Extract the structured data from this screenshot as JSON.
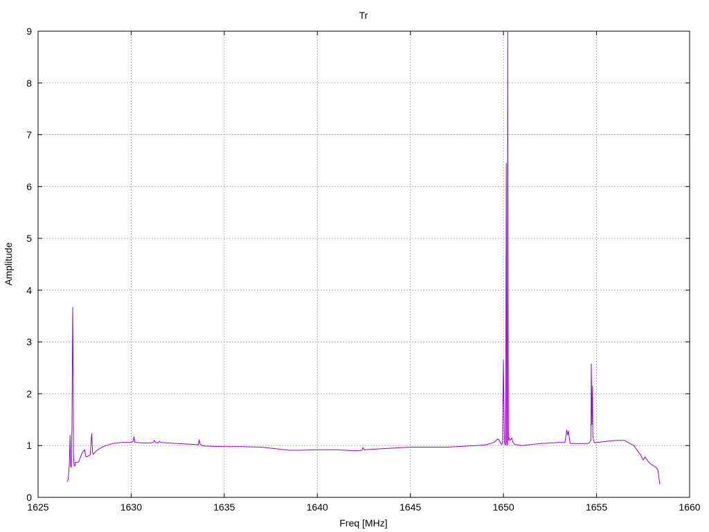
{
  "chart_data": {
    "type": "line",
    "title": "Tr",
    "xlabel": "Freq [MHz]",
    "ylabel": "Amplitude",
    "xlim": [
      1625,
      1660
    ],
    "ylim": [
      0,
      9
    ],
    "xticks": [
      1625,
      1630,
      1635,
      1640,
      1645,
      1650,
      1655,
      1660
    ],
    "yticks": [
      0,
      1,
      2,
      3,
      4,
      5,
      6,
      7,
      8,
      9
    ],
    "grid": true,
    "legend": "none",
    "series": [
      {
        "color": "#9400d3",
        "x": [
          1626.55,
          1626.62,
          1626.68,
          1626.72,
          1626.75,
          1626.78,
          1626.82,
          1626.86,
          1626.88,
          1626.9,
          1626.93,
          1626.97,
          1627.0,
          1627.1,
          1627.2,
          1627.3,
          1627.4,
          1627.5,
          1627.55,
          1627.6,
          1627.7,
          1627.8,
          1627.88,
          1627.93,
          1627.97,
          1628.0,
          1628.2,
          1628.5,
          1629.0,
          1629.5,
          1630.0,
          1630.1,
          1630.15,
          1630.2,
          1630.3,
          1630.6,
          1631.0,
          1631.2,
          1631.25,
          1631.3,
          1631.45,
          1631.5,
          1631.6,
          1632.0,
          1632.5,
          1633.0,
          1633.5,
          1633.6,
          1633.65,
          1633.7,
          1633.8,
          1634.0,
          1635.0,
          1636.0,
          1637.0,
          1638.0,
          1638.5,
          1639.0,
          1640.0,
          1641.0,
          1642.0,
          1642.4,
          1642.45,
          1642.5,
          1643.0,
          1644.0,
          1645.0,
          1646.0,
          1647.0,
          1648.0,
          1649.0,
          1649.5,
          1649.7,
          1649.8,
          1649.9,
          1649.95,
          1650.0,
          1650.05,
          1650.08,
          1650.12,
          1650.15,
          1650.18,
          1650.21,
          1650.23,
          1650.25,
          1650.27,
          1650.3,
          1650.35,
          1650.4,
          1650.45,
          1650.5,
          1650.6,
          1651.0,
          1652.0,
          1653.0,
          1653.3,
          1653.4,
          1653.45,
          1653.5,
          1653.55,
          1653.6,
          1654.0,
          1654.5,
          1654.6,
          1654.7,
          1654.72,
          1654.75,
          1654.78,
          1654.8,
          1654.85,
          1654.9,
          1655.0,
          1655.5,
          1656.0,
          1656.5,
          1657.0,
          1657.2,
          1657.4,
          1657.5,
          1657.6,
          1657.8,
          1658.0,
          1658.2,
          1658.3,
          1658.4
        ],
        "y": [
          0.3,
          0.35,
          0.65,
          1.2,
          0.6,
          0.58,
          1.35,
          3.67,
          2.75,
          0.85,
          0.62,
          0.6,
          0.68,
          0.67,
          0.7,
          0.8,
          0.88,
          0.92,
          0.8,
          0.78,
          0.8,
          0.82,
          1.23,
          0.85,
          0.83,
          0.85,
          0.92,
          0.98,
          1.04,
          1.06,
          1.06,
          1.08,
          1.17,
          1.07,
          1.06,
          1.05,
          1.05,
          1.06,
          1.1,
          1.06,
          1.05,
          1.08,
          1.06,
          1.05,
          1.04,
          1.03,
          1.02,
          1.01,
          1.11,
          1.03,
          1.0,
          0.99,
          0.98,
          0.98,
          0.97,
          0.93,
          0.91,
          0.91,
          0.92,
          0.92,
          0.9,
          0.91,
          0.96,
          0.92,
          0.93,
          0.95,
          0.97,
          0.97,
          0.97,
          0.99,
          1.01,
          1.06,
          1.13,
          1.08,
          1.02,
          1.05,
          2.65,
          1.05,
          1.02,
          1.01,
          6.45,
          1.05,
          1.0,
          9.0,
          3.2,
          1.1,
          1.15,
          1.1,
          1.12,
          1.15,
          1.07,
          1.02,
          1.0,
          1.04,
          1.06,
          1.06,
          1.3,
          1.2,
          1.28,
          1.1,
          1.04,
          1.04,
          1.04,
          1.05,
          1.1,
          2.58,
          1.4,
          2.15,
          1.2,
          1.08,
          1.05,
          1.06,
          1.08,
          1.1,
          1.1,
          1.0,
          0.9,
          0.8,
          0.72,
          0.78,
          0.68,
          0.62,
          0.58,
          0.52,
          0.25
        ]
      }
    ]
  }
}
